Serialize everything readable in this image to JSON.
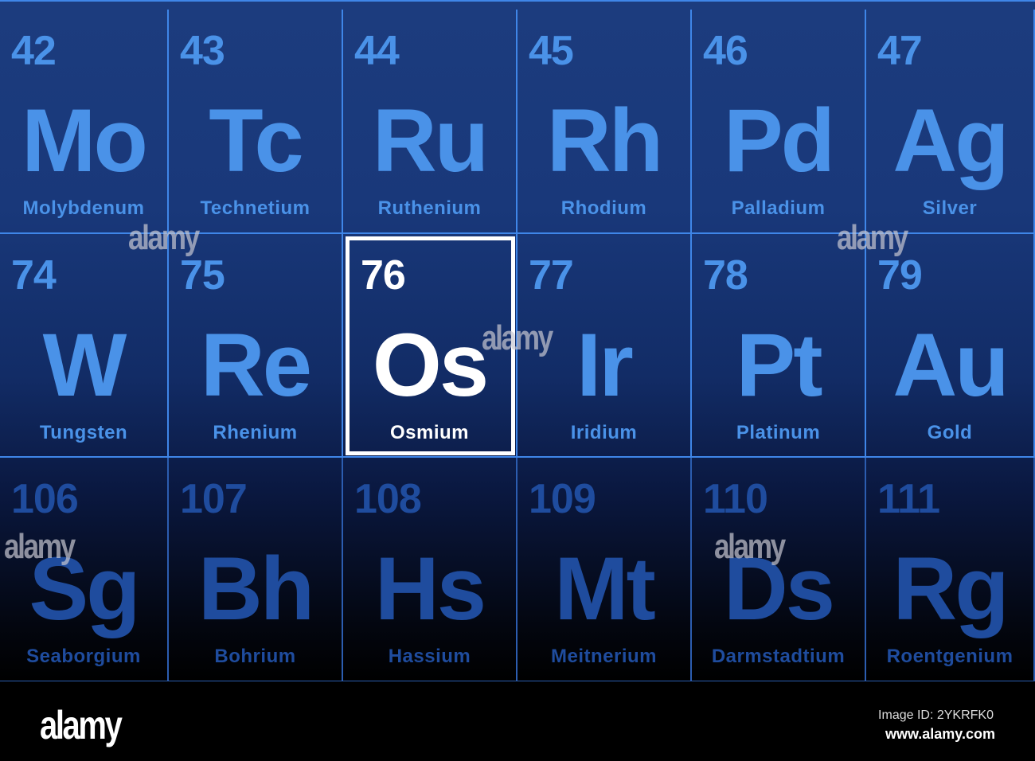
{
  "rows": [
    [
      {
        "n": "42",
        "s": "Mo",
        "name": "Molybdenum"
      },
      {
        "n": "43",
        "s": "Tc",
        "name": "Technetium"
      },
      {
        "n": "44",
        "s": "Ru",
        "name": "Ruthenium"
      },
      {
        "n": "45",
        "s": "Rh",
        "name": "Rhodium"
      },
      {
        "n": "46",
        "s": "Pd",
        "name": "Palladium"
      },
      {
        "n": "47",
        "s": "Ag",
        "name": "Silver"
      }
    ],
    [
      {
        "n": "74",
        "s": "W",
        "name": "Tungsten"
      },
      {
        "n": "75",
        "s": "Re",
        "name": "Rhenium"
      },
      {
        "n": "76",
        "s": "Os",
        "name": "Osmium",
        "selected": true
      },
      {
        "n": "77",
        "s": "Ir",
        "name": "Iridium"
      },
      {
        "n": "78",
        "s": "Pt",
        "name": "Platinum"
      },
      {
        "n": "79",
        "s": "Au",
        "name": "Gold"
      }
    ],
    [
      {
        "n": "106",
        "s": "Sg",
        "name": "Seaborgium"
      },
      {
        "n": "107",
        "s": "Bh",
        "name": "Bohrium"
      },
      {
        "n": "108",
        "s": "Hs",
        "name": "Hassium"
      },
      {
        "n": "109",
        "s": "Mt",
        "name": "Meitnerium"
      },
      {
        "n": "110",
        "s": "Ds",
        "name": "Darmstadtium"
      },
      {
        "n": "111",
        "s": "Rg",
        "name": "Roentgenium"
      }
    ]
  ],
  "watermark": "alamy",
  "footer": {
    "logo": "alamy",
    "image_id": "Image ID: 2YKRFK0",
    "site": "www.alamy.com"
  },
  "colors": {
    "grid": "#3f86e8",
    "text": "#4a92e8",
    "selected": "#ffffff"
  }
}
